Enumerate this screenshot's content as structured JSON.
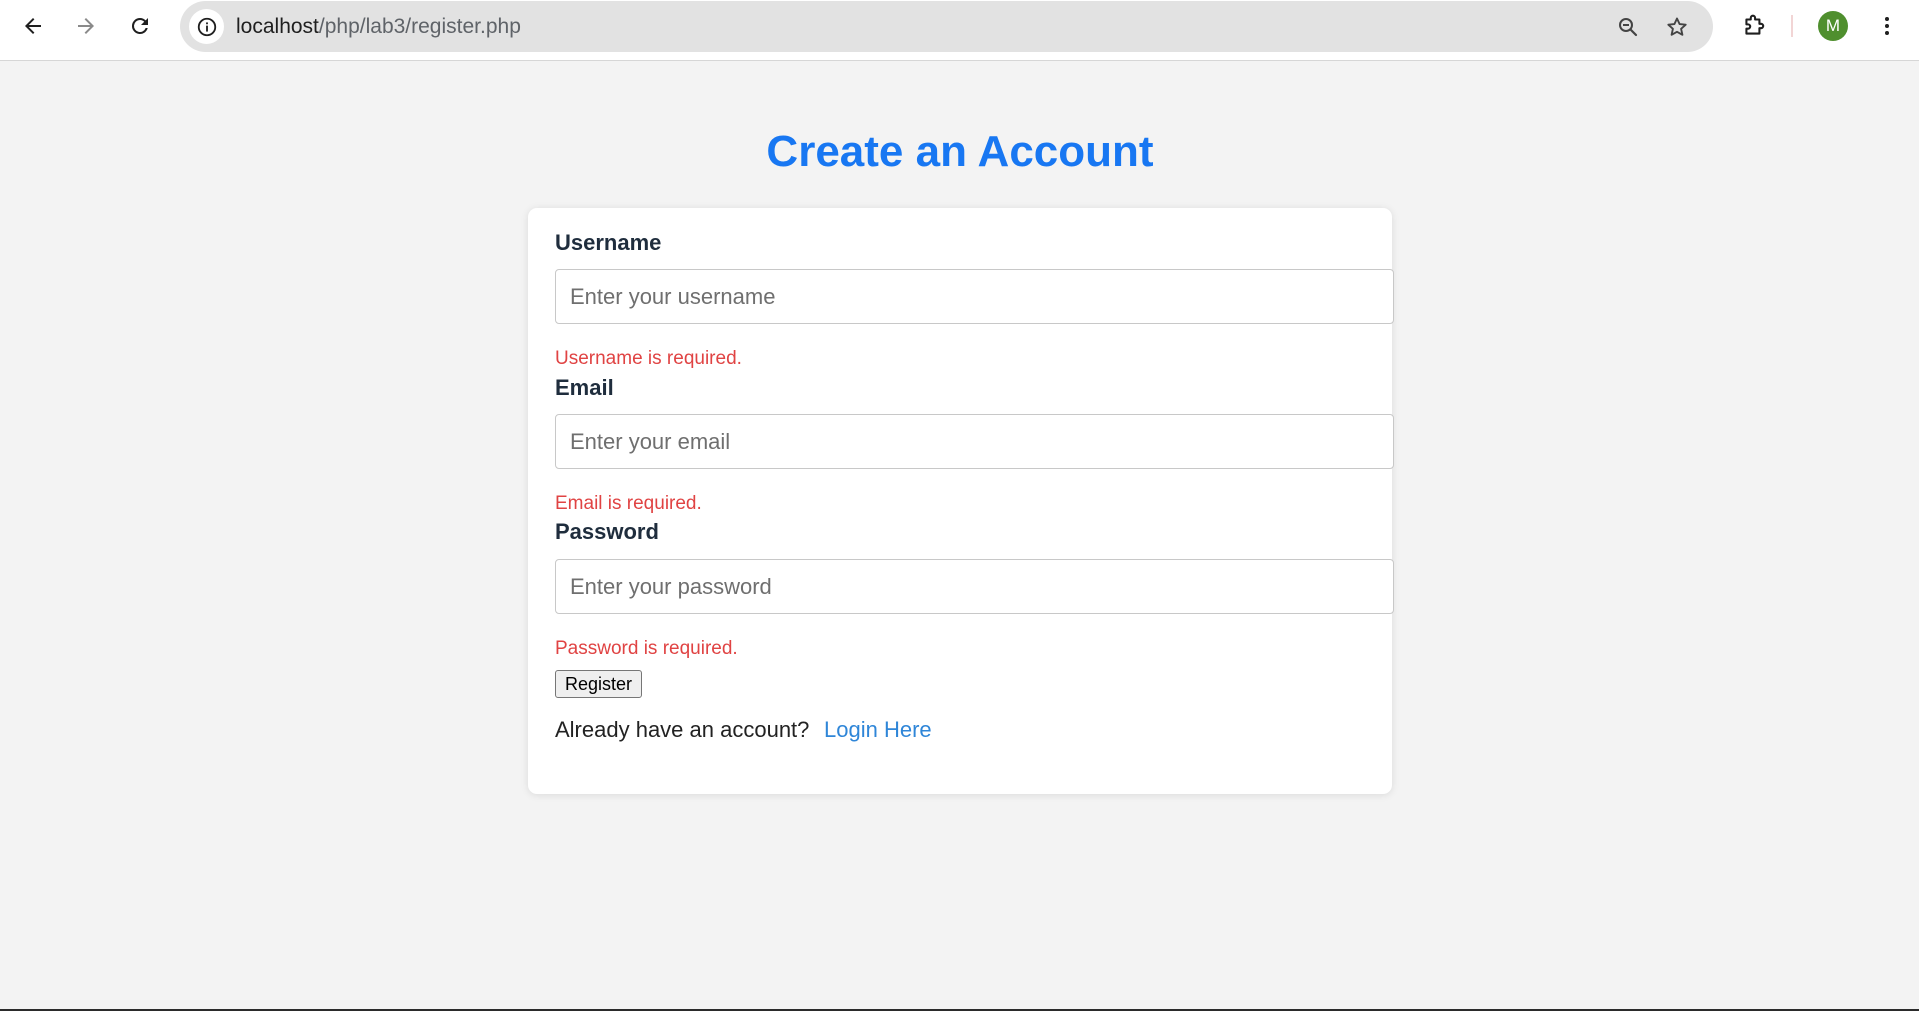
{
  "browser": {
    "url_host": "localhost",
    "url_path": "/php/lab3/register.php",
    "profile_initial": "M",
    "profile_color": "#4f8f2e",
    "icons": {
      "back": "back-arrow-icon",
      "forward": "forward-arrow-icon",
      "reload": "reload-icon",
      "site_info": "info-icon",
      "zoom": "zoom-out-icon",
      "bookmark": "star-icon",
      "extensions": "puzzle-icon",
      "menu": "kebab-menu-icon"
    }
  },
  "page": {
    "title": "Create an Account",
    "title_color": "#1877f2",
    "form": {
      "username": {
        "label": "Username",
        "placeholder": "Enter your username",
        "value": "",
        "error": "Username is required."
      },
      "email": {
        "label": "Email",
        "placeholder": "Enter your email",
        "value": "",
        "error": "Email is required."
      },
      "password": {
        "label": "Password",
        "placeholder": "Enter your password",
        "value": "",
        "error": "Password is required."
      },
      "submit_label": "Register",
      "error_color": "#e04343"
    },
    "login_prompt": "Already have an account?",
    "login_link": "Login Here",
    "link_color": "#2f86d8"
  }
}
